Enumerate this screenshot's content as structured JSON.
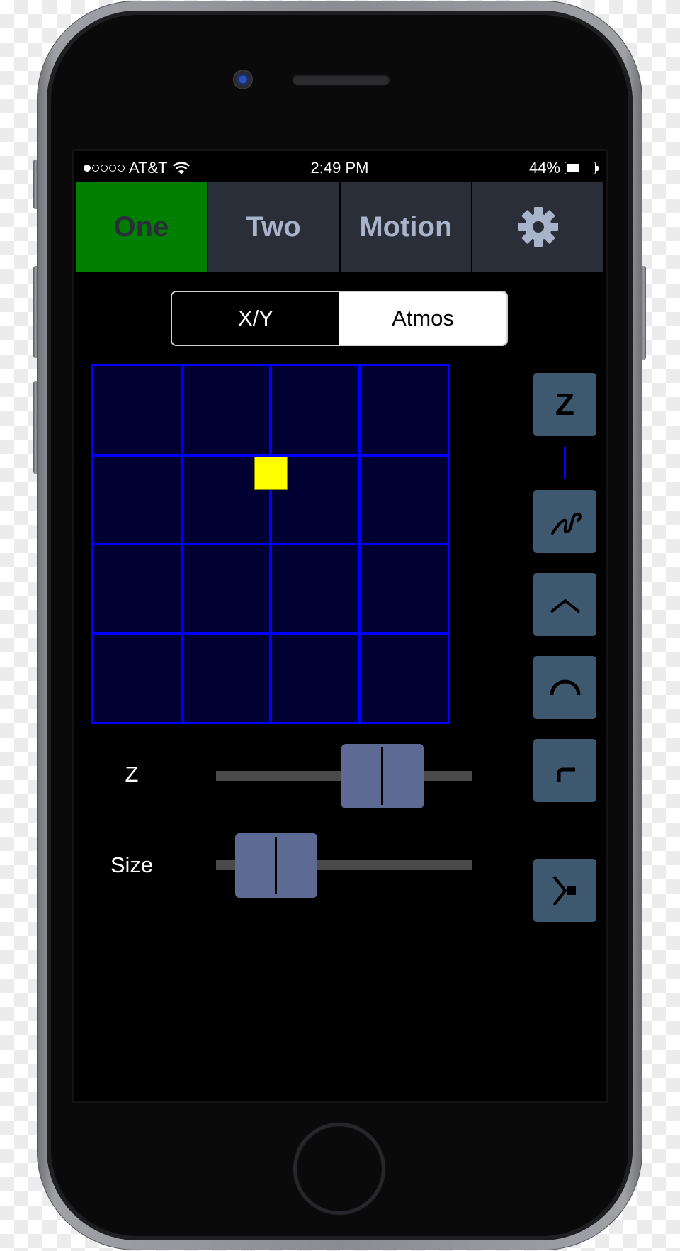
{
  "status_bar": {
    "signal_bars_filled": 1,
    "signal_bars_total": 5,
    "carrier": "AT&T",
    "wifi_icon": "wifi-icon",
    "time": "2:49 PM",
    "battery_percent_label": "44%",
    "battery_level": 0.44
  },
  "tabs": [
    {
      "label": "One",
      "active": true
    },
    {
      "label": "Two",
      "active": false
    },
    {
      "label": "Motion",
      "active": false
    },
    {
      "label": "",
      "icon": "gear-icon",
      "active": false
    }
  ],
  "mode_toggle": {
    "options": [
      {
        "label": "X/Y",
        "selected": true
      },
      {
        "label": "Atmos",
        "selected": false
      }
    ]
  },
  "xy_pad": {
    "grid_divisions": 4,
    "puck_x": 0.5,
    "puck_y": 0.3,
    "colors": {
      "background": "#000033",
      "grid": "#0000ff",
      "puck": "#ffff00"
    }
  },
  "sliders": [
    {
      "label": "Z",
      "value": 0.72
    },
    {
      "label": "Size",
      "value": 0.11
    }
  ],
  "tool_buttons": [
    {
      "name": "z-button",
      "label": "Z",
      "icon": "z-icon"
    },
    {
      "name": "freehand-path-button",
      "icon": "squiggle-icon"
    },
    {
      "name": "chevron-path-button",
      "icon": "chevron-up-icon"
    },
    {
      "name": "arc-path-button",
      "icon": "arc-icon"
    },
    {
      "name": "corner-path-button",
      "icon": "corner-icon"
    },
    {
      "name": "send-to-point-button",
      "icon": "chevron-right-square-icon"
    }
  ],
  "colors": {
    "active_tab": "#007f00",
    "tab_bg": "#2a2e38",
    "tab_text": "#a7b4c9",
    "tool_button": "#3e5870",
    "slider_thumb": "#5d6b94"
  }
}
